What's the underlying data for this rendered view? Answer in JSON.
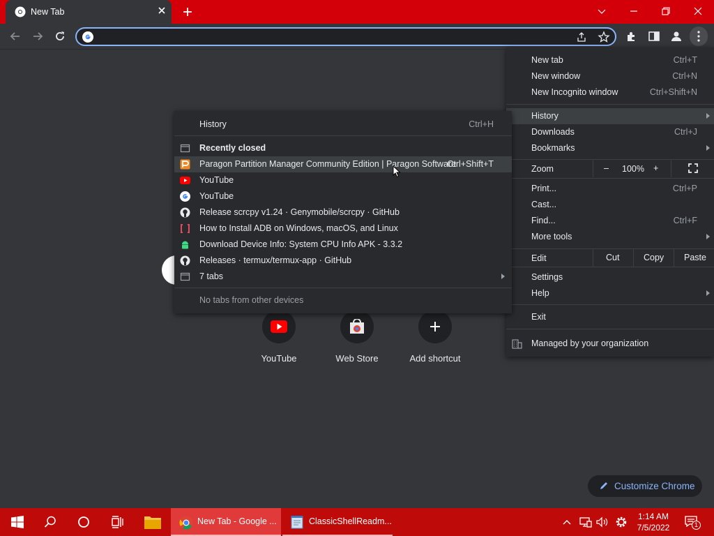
{
  "tab": {
    "title": "New Tab"
  },
  "main_menu": {
    "new_tab": {
      "label": "New tab",
      "shortcut": "Ctrl+T"
    },
    "new_window": {
      "label": "New window",
      "shortcut": "Ctrl+N"
    },
    "new_incognito": {
      "label": "New Incognito window",
      "shortcut": "Ctrl+Shift+N"
    },
    "history": {
      "label": "History"
    },
    "downloads": {
      "label": "Downloads",
      "shortcut": "Ctrl+J"
    },
    "bookmarks": {
      "label": "Bookmarks"
    },
    "zoom": {
      "label": "Zoom",
      "minus": "–",
      "level": "100%",
      "plus": "+"
    },
    "print": {
      "label": "Print...",
      "shortcut": "Ctrl+P"
    },
    "cast": {
      "label": "Cast..."
    },
    "find": {
      "label": "Find...",
      "shortcut": "Ctrl+F"
    },
    "more_tools": {
      "label": "More tools"
    },
    "edit": {
      "label": "Edit",
      "cut": "Cut",
      "copy": "Copy",
      "paste": "Paste"
    },
    "settings": {
      "label": "Settings"
    },
    "help": {
      "label": "Help"
    },
    "exit": {
      "label": "Exit"
    },
    "managed": {
      "label": "Managed by your organization"
    }
  },
  "history_menu": {
    "history": {
      "label": "History",
      "shortcut": "Ctrl+H"
    },
    "recently_closed": "Recently closed",
    "items": [
      {
        "label": "Paragon Partition Manager Community Edition | Paragon Software",
        "shortcut": "Ctrl+Shift+T",
        "icon": "paragon-icon"
      },
      {
        "label": "YouTube",
        "icon": "youtube-icon"
      },
      {
        "label": "YouTube",
        "icon": "google-icon"
      },
      {
        "label": "Release scrcpy v1.24 · Genymobile/scrcpy · GitHub",
        "icon": "github-icon"
      },
      {
        "label": "How to Install ADB on Windows, macOS, and Linux",
        "icon": "xda-icon"
      },
      {
        "label": "Download Device Info: System  CPU Info APK - 3.3.2",
        "icon": "android-icon"
      },
      {
        "label": "Releases · termux/termux-app · GitHub",
        "icon": "github-icon"
      },
      {
        "label": "7 tabs",
        "icon": "window-icon"
      }
    ],
    "no_tabs": "No tabs from other devices"
  },
  "shortcuts": [
    {
      "label": "YouTube"
    },
    {
      "label": "Web Store"
    },
    {
      "label": "Add shortcut"
    }
  ],
  "customize": {
    "label": "Customize Chrome"
  },
  "taskbar": {
    "chrome_app": "New Tab - Google ...",
    "notepad_app": "ClassicShellReadm...",
    "time": "1:14 AM",
    "date": "7/5/2022",
    "notification_count": "1"
  },
  "colors": {
    "titlebar": "#d3000a",
    "taskbar": "#bf0a0a",
    "accent": "#8ab4f8",
    "background": "#35363a"
  }
}
